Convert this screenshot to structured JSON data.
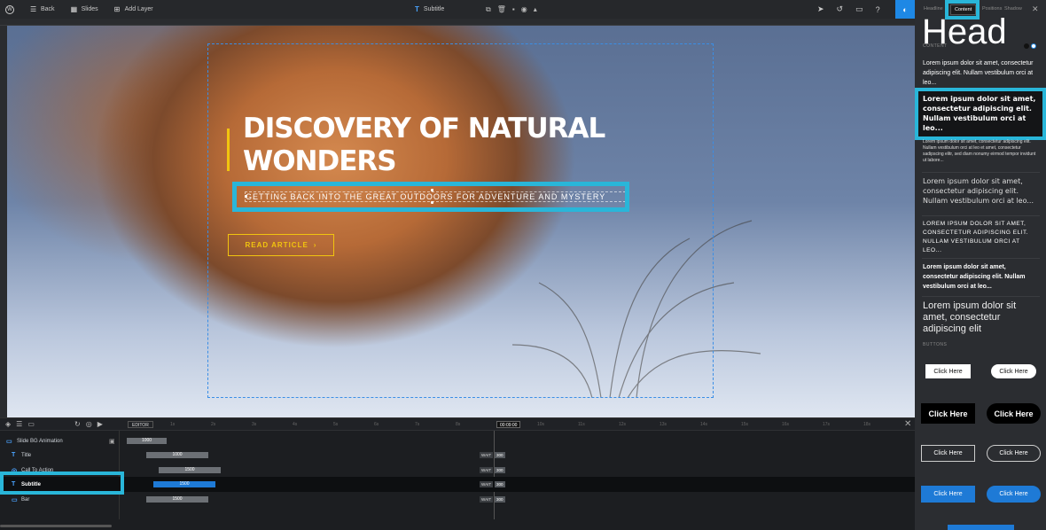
{
  "topbar": {
    "back_label": "Back",
    "slides_label": "Slides",
    "add_layer_label": "Add Layer",
    "layer_type": "T",
    "current_layer": "Subtitle"
  },
  "canvas": {
    "title": "DISCOVERY OF NATURAL WONDERS",
    "subtitle": "GETTING BACK INTO THE GREAT OUTDOORS FOR ADVENTURE AND MYSTERY",
    "cta_label": "READ ARTICLE",
    "cta_icon": "chevron-right"
  },
  "timeline": {
    "editor_label": "EDITOR",
    "time": "00:09:00",
    "ticks": [
      "1s",
      "2s",
      "3s",
      "4s",
      "5s",
      "6s",
      "7s",
      "8s",
      "9s",
      "10s",
      "11s",
      "12s",
      "13s",
      "14s",
      "15s",
      "16s",
      "17s",
      "18s"
    ],
    "layers": [
      {
        "name": "Slide BG Animation",
        "bar": "1000"
      },
      {
        "name": "Title",
        "bar": "1000",
        "wait": "WAIT",
        "wait_val": "300"
      },
      {
        "name": "Call To Action",
        "bar": "1500",
        "wait": "WAIT",
        "wait_val": "300"
      },
      {
        "name": "Subtitle",
        "bar": "1500",
        "wait": "WAIT",
        "wait_val": "300"
      },
      {
        "name": "Bar",
        "bar": "1500",
        "wait": "WAIT",
        "wait_val": "300"
      }
    ]
  },
  "panel": {
    "tabs": [
      "Headline",
      "Content",
      "Positions",
      "Shadow"
    ],
    "active_tab": "Content",
    "big_heading": "Head",
    "content_label": "CONTENT",
    "buttons_label": "BUTTONS",
    "presets": [
      "Lorem ipsum dolor sit amet, consectetur adipiscing elit. Nullam vestibulum orci at leo...",
      "Lorem ipsum dolor sit amet, consectetur adipiscing elit. Nullam vestibulum orci at leo...",
      "Lorem ipsum dolor sit amet, consectetur adipiscing elit. Nullam vestibulum orci at leo et amet, consectetur sadipscing elitr, sed diam nonumy eirmod tempor invidunt ut labore...",
      "Lorem ipsum dolor sit amet, consectetur adipiscing elit. Nullam vestibulum orci at leo...",
      "LOREM IPSUM DOLOR SIT AMET, CONSECTETUR ADIPISCING ELIT. NULLAM VESTIBULUM ORCI AT LEO...",
      "Lorem ipsum dolor sit amet, consectetur adipiscing elit. Nullam vestibulum orci at leo...",
      "Lorem ipsum dolor sit amet, consectetur adipiscing elit"
    ],
    "button_label": "Click Here"
  },
  "colors": {
    "accent_yellow": "#f1c40f",
    "highlight_cyan": "#29b6d9",
    "primary_blue": "#1e7ad6"
  }
}
